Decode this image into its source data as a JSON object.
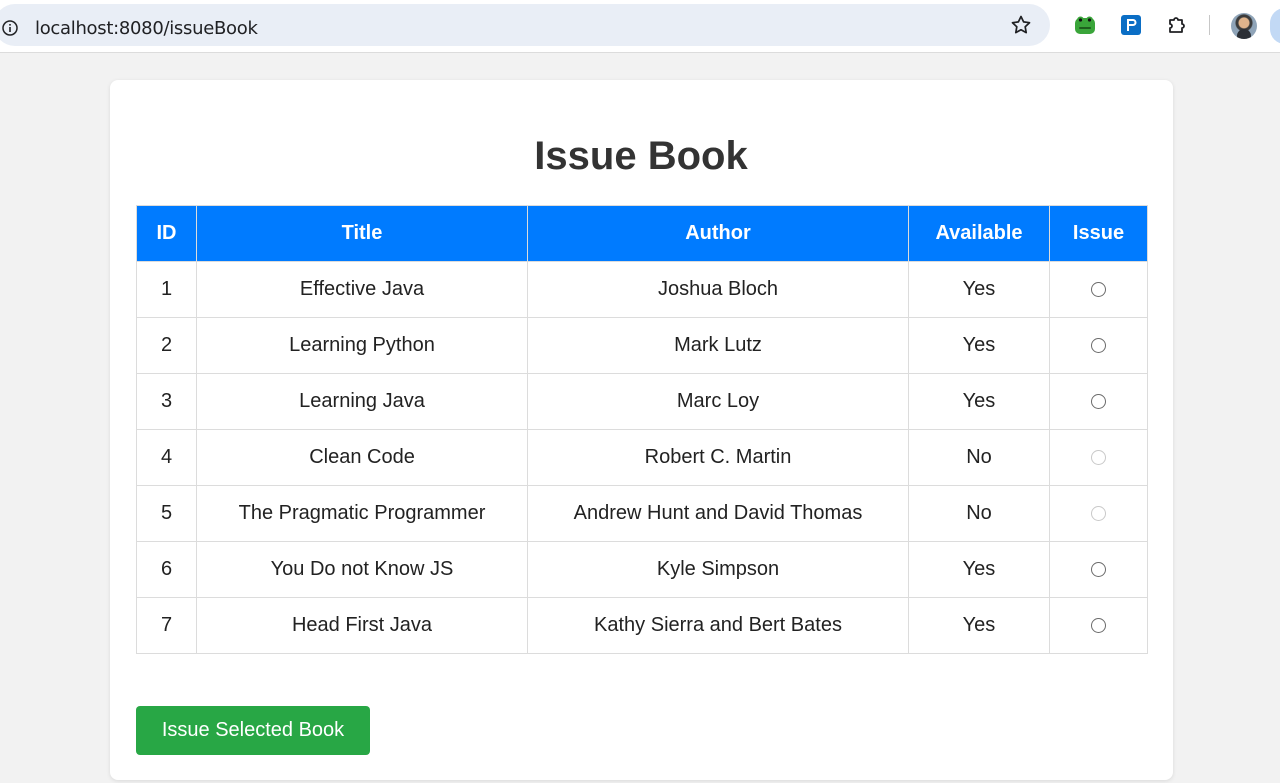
{
  "browser": {
    "url": "localhost:8080/issueBook",
    "icons": {
      "info": "info-icon",
      "bookmark": "star-icon",
      "ext1": "frog-extension-icon",
      "ext2": "p-extension-icon",
      "ext3": "puzzle-extensions-icon",
      "profile": "avatar"
    }
  },
  "page": {
    "title": "Issue Book",
    "accent_color": "#007bff",
    "button_color": "#28a745"
  },
  "table": {
    "headers": {
      "id": "ID",
      "title": "Title",
      "author": "Author",
      "available": "Available",
      "issue": "Issue"
    },
    "rows": [
      {
        "id": "1",
        "title": "Effective Java",
        "author": "Joshua Bloch",
        "available": "Yes",
        "issuable": true
      },
      {
        "id": "2",
        "title": "Learning Python",
        "author": "Mark Lutz",
        "available": "Yes",
        "issuable": true
      },
      {
        "id": "3",
        "title": "Learning Java",
        "author": "Marc Loy",
        "available": "Yes",
        "issuable": true
      },
      {
        "id": "4",
        "title": "Clean Code",
        "author": "Robert C. Martin",
        "available": "No",
        "issuable": false
      },
      {
        "id": "5",
        "title": "The Pragmatic Programmer",
        "author": "Andrew Hunt and David Thomas",
        "available": "No",
        "issuable": false
      },
      {
        "id": "6",
        "title": "You Do not Know JS",
        "author": "Kyle Simpson",
        "available": "Yes",
        "issuable": true
      },
      {
        "id": "7",
        "title": "Head First Java",
        "author": "Kathy Sierra and Bert Bates",
        "available": "Yes",
        "issuable": true
      }
    ]
  },
  "actions": {
    "issue_label": "Issue Selected Book"
  }
}
